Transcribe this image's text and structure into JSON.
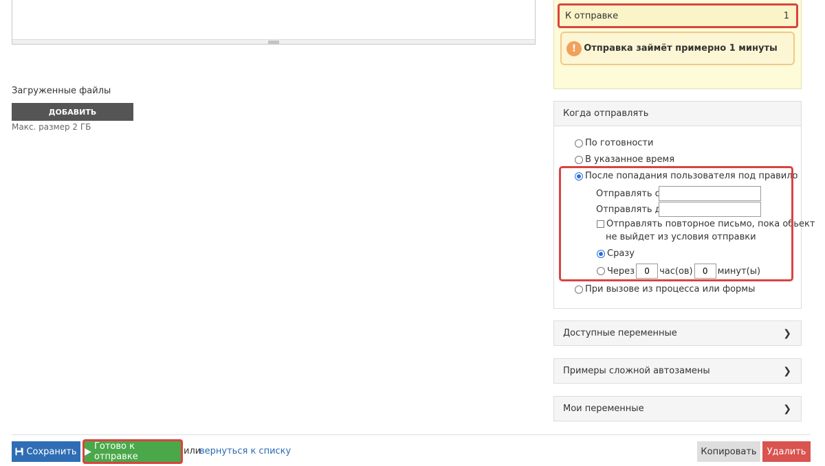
{
  "files": {
    "label": "Загруженные файлы",
    "add_button": "ДОБАВИТЬ",
    "max_size": "Макс. размер 2 ГБ"
  },
  "status": {
    "to_send_label": "К отправке",
    "to_send_count": "1",
    "notice_icon": "!",
    "notice_text": "Отправка займёт примерно 1 минуты"
  },
  "when": {
    "header": "Когда отправлять",
    "options": {
      "ready": "По готовности",
      "scheduled": "В указанное время",
      "rule": "После попадания пользователя под правило",
      "process": "При вызове из процесса или формы"
    },
    "selected": "rule",
    "send_from_label": "Отправлять с",
    "send_from_value": "",
    "send_to_label": "Отправлять до",
    "send_to_value": "",
    "repeat_line1": "Отправлять повторное письмо, пока обьект",
    "repeat_line2": "не выйдет из условия отправки",
    "repeat_checked": false,
    "immediately": "Сразу",
    "after_label": "Через",
    "hours_value": "0",
    "hours_unit": "час(ов)",
    "minutes_value": "0",
    "minutes_unit": "минут(ы)"
  },
  "accordions": {
    "variables": "Доступные переменные",
    "examples": "Примеры сложной автозамены",
    "my_vars": "Мои переменные"
  },
  "footer": {
    "save": "Сохранить",
    "ready": "Готово к отправке",
    "or": "или",
    "back": "вернуться к списку",
    "copy": "Копировать",
    "delete": "Удалить"
  },
  "colors": {
    "accent_red": "#d9433f",
    "save_blue": "#2f6db5",
    "ready_green": "#4aa84a",
    "delete_red": "#d9534f",
    "status_bg": "#fdfbd8"
  },
  "icons": [
    "floppy-icon",
    "play-icon",
    "chevron-right-icon",
    "exclamation-icon"
  ]
}
